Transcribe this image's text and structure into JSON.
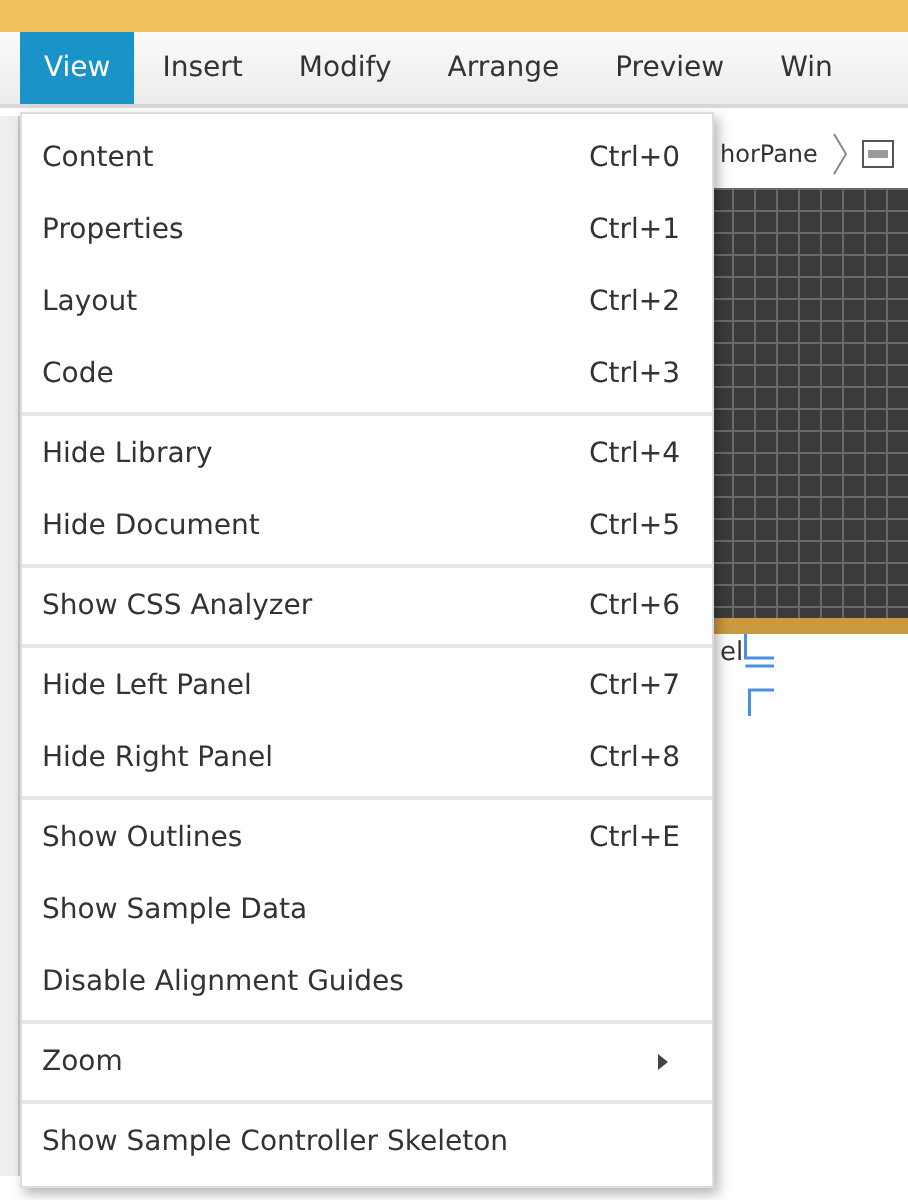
{
  "menubar": [
    {
      "label": "View",
      "selected": true
    },
    {
      "label": "Insert",
      "selected": false
    },
    {
      "label": "Modify",
      "selected": false
    },
    {
      "label": "Arrange",
      "selected": false
    },
    {
      "label": "Preview",
      "selected": false
    },
    {
      "label": "Win",
      "selected": false
    }
  ],
  "breadcrumb": {
    "text": "horPane"
  },
  "canvas": {
    "label": "el"
  },
  "menu": {
    "groups": [
      [
        {
          "kind": "item",
          "label": "Content",
          "shortcut": "Ctrl+0"
        },
        {
          "kind": "item",
          "label": "Properties",
          "shortcut": "Ctrl+1"
        },
        {
          "kind": "item",
          "label": "Layout",
          "shortcut": "Ctrl+2"
        },
        {
          "kind": "item",
          "label": "Code",
          "shortcut": "Ctrl+3"
        }
      ],
      [
        {
          "kind": "item",
          "label": "Hide Library",
          "shortcut": "Ctrl+4"
        },
        {
          "kind": "item",
          "label": "Hide Document",
          "shortcut": "Ctrl+5"
        }
      ],
      [
        {
          "kind": "item",
          "label": "Show CSS Analyzer",
          "shortcut": "Ctrl+6"
        }
      ],
      [
        {
          "kind": "item",
          "label": "Hide Left Panel",
          "shortcut": "Ctrl+7"
        },
        {
          "kind": "item",
          "label": "Hide Right Panel",
          "shortcut": "Ctrl+8"
        }
      ],
      [
        {
          "kind": "item",
          "label": "Show Outlines",
          "shortcut": "Ctrl+E"
        },
        {
          "kind": "item",
          "label": "Show Sample Data"
        },
        {
          "kind": "item",
          "label": "Disable Alignment Guides"
        }
      ],
      [
        {
          "kind": "submenu",
          "label": "Zoom"
        }
      ],
      [
        {
          "kind": "item",
          "label": "Show Sample Controller Skeleton"
        }
      ]
    ]
  }
}
